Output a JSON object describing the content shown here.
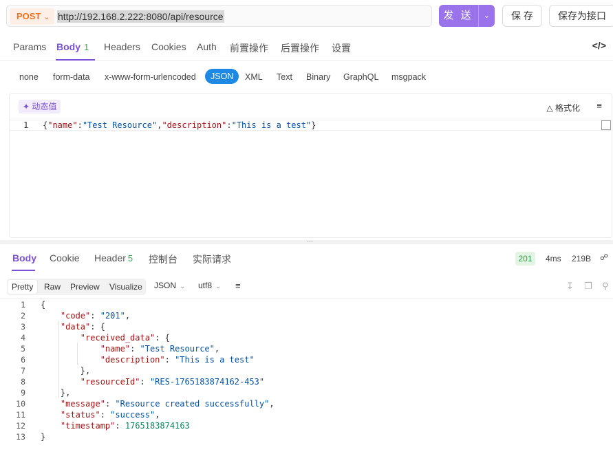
{
  "request": {
    "method": "POST",
    "url": "http://192.168.2.222:8080/api/resource",
    "send_label": "发 送",
    "save_label": "保 存",
    "save_as_label": "保存为接口"
  },
  "req_tabs": [
    {
      "label": "Params"
    },
    {
      "label": "Body",
      "count": "1"
    },
    {
      "label": "Headers"
    },
    {
      "label": "Cookies"
    },
    {
      "label": "Auth"
    },
    {
      "label": "前置操作"
    },
    {
      "label": "后置操作"
    },
    {
      "label": "设置"
    }
  ],
  "body_types": [
    "none",
    "form-data",
    "x-www-form-urlencoded",
    "JSON",
    "XML",
    "Text",
    "Binary",
    "GraphQL",
    "msgpack"
  ],
  "editor": {
    "dynamic_label": "动态值",
    "format_label": "格式化",
    "line_number": "1",
    "line_tokens": [
      {
        "t": "{",
        "c": ""
      },
      {
        "t": "\"name\"",
        "c": "k"
      },
      {
        "t": ":",
        "c": ""
      },
      {
        "t": "\"Test Resource\"",
        "c": "s"
      },
      {
        "t": ",",
        "c": ""
      },
      {
        "t": "\"description\"",
        "c": "k"
      },
      {
        "t": ":",
        "c": ""
      },
      {
        "t": "\"This is a test\"",
        "c": "s"
      },
      {
        "t": "}",
        "c": ""
      }
    ]
  },
  "resp_tabs": [
    {
      "label": "Body"
    },
    {
      "label": "Cookie"
    },
    {
      "label": "Header",
      "count": "5"
    },
    {
      "label": "控制台"
    },
    {
      "label": "实际请求"
    }
  ],
  "resp_meta": {
    "status": "201",
    "time": "4ms",
    "size": "219B"
  },
  "resp_views": [
    "Pretty",
    "Raw",
    "Preview",
    "Visualize"
  ],
  "resp_format": "JSON",
  "resp_encoding": "utf8",
  "resp_lines": [
    {
      "n": "1",
      "tokens": [
        {
          "t": "{",
          "c": ""
        }
      ]
    },
    {
      "n": "2",
      "tokens": [
        {
          "t": "    ",
          "c": ""
        },
        {
          "t": "\"code\"",
          "c": "k"
        },
        {
          "t": ": ",
          "c": ""
        },
        {
          "t": "\"201\"",
          "c": "s"
        },
        {
          "t": ",",
          "c": ""
        }
      ]
    },
    {
      "n": "3",
      "tokens": [
        {
          "t": "    ",
          "c": ""
        },
        {
          "t": "\"data\"",
          "c": "k"
        },
        {
          "t": ": {",
          "c": ""
        }
      ]
    },
    {
      "n": "4",
      "tokens": [
        {
          "t": "        ",
          "c": ""
        },
        {
          "t": "\"received_data\"",
          "c": "k"
        },
        {
          "t": ": {",
          "c": ""
        }
      ]
    },
    {
      "n": "5",
      "tokens": [
        {
          "t": "            ",
          "c": ""
        },
        {
          "t": "\"name\"",
          "c": "k"
        },
        {
          "t": ": ",
          "c": ""
        },
        {
          "t": "\"Test Resource\"",
          "c": "s"
        },
        {
          "t": ",",
          "c": ""
        }
      ]
    },
    {
      "n": "6",
      "tokens": [
        {
          "t": "            ",
          "c": ""
        },
        {
          "t": "\"description\"",
          "c": "k"
        },
        {
          "t": ": ",
          "c": ""
        },
        {
          "t": "\"This is a test\"",
          "c": "s"
        }
      ]
    },
    {
      "n": "7",
      "tokens": [
        {
          "t": "        },",
          "c": ""
        }
      ]
    },
    {
      "n": "8",
      "tokens": [
        {
          "t": "        ",
          "c": ""
        },
        {
          "t": "\"resourceId\"",
          "c": "k"
        },
        {
          "t": ": ",
          "c": ""
        },
        {
          "t": "\"RES-1765183874162-453\"",
          "c": "s"
        }
      ]
    },
    {
      "n": "9",
      "tokens": [
        {
          "t": "    },",
          "c": ""
        }
      ]
    },
    {
      "n": "10",
      "tokens": [
        {
          "t": "    ",
          "c": ""
        },
        {
          "t": "\"message\"",
          "c": "k"
        },
        {
          "t": ": ",
          "c": ""
        },
        {
          "t": "\"Resource created successfully\"",
          "c": "s"
        },
        {
          "t": ",",
          "c": ""
        }
      ]
    },
    {
      "n": "11",
      "tokens": [
        {
          "t": "    ",
          "c": ""
        },
        {
          "t": "\"status\"",
          "c": "k"
        },
        {
          "t": ": ",
          "c": ""
        },
        {
          "t": "\"success\"",
          "c": "s"
        },
        {
          "t": ",",
          "c": ""
        }
      ]
    },
    {
      "n": "12",
      "tokens": [
        {
          "t": "    ",
          "c": ""
        },
        {
          "t": "\"timestamp\"",
          "c": "k"
        },
        {
          "t": ": ",
          "c": ""
        },
        {
          "t": "1765183874163",
          "c": "n"
        }
      ]
    },
    {
      "n": "13",
      "tokens": [
        {
          "t": "}",
          "c": ""
        }
      ]
    }
  ],
  "colors": {
    "accent": "#7b52d6",
    "send": "#9a72e9",
    "method": "#f2711c",
    "json_active": "#1e88e5",
    "status_ok": "#2f9e44"
  },
  "icons": [
    "chevron-down-icon",
    "code-icon",
    "magic-wand-icon",
    "format-icon",
    "wrap-icon",
    "share-icon",
    "download-icon",
    "copy-icon",
    "search-icon"
  ]
}
